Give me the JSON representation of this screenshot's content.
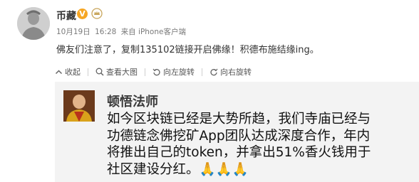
{
  "post": {
    "username": "币藏",
    "verified_badge": "V",
    "date": "10月19日",
    "time": "16:28",
    "source": "来自 iPhone客户端",
    "text": "佛友们注意了，复制135102链接开启佛缘！积德布施结缘ing。"
  },
  "toolbar": {
    "collapse": "收起",
    "view_large": "查看大图",
    "rotate_left": "向左旋转",
    "rotate_right": "向右旋转"
  },
  "image": {
    "poster_name": "顿悟法师",
    "lines": [
      "如今区块链已经是大势所趋，我们寺庙已经与",
      "功德链念佛挖矿App团队达成深度合作，年内",
      "将推出自己的token，并拿出51%香火钱用于",
      "社区建设分红。"
    ],
    "emoji": "🙏🙏🙏"
  },
  "colors": {
    "verified": "#f6a623",
    "meta_text": "#7a7a7a",
    "image_bg": "#f3f3f3"
  },
  "icons": [
    "avatar",
    "verified-icon",
    "vip-icon",
    "collapse-icon",
    "zoom-icon",
    "rotate-left-icon",
    "rotate-right-icon",
    "pray-emoji"
  ]
}
